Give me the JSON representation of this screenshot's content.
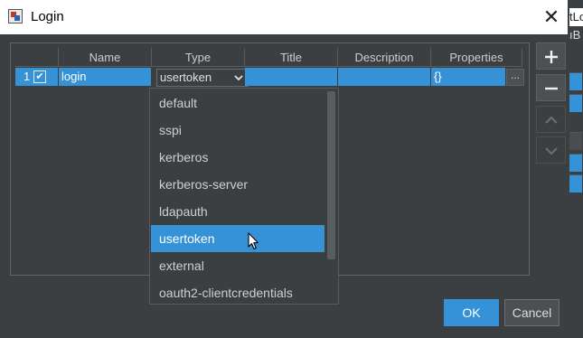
{
  "window": {
    "title": "Login",
    "close_symbol": "✕"
  },
  "background_peek": {
    "line1": "tLo",
    "line2": "ıB"
  },
  "table": {
    "columns": [
      "Name",
      "Type",
      "Title",
      "Description",
      "Properties"
    ],
    "rows": [
      {
        "index": "1",
        "enabled": true,
        "name": "login",
        "type": "usertoken",
        "title": "",
        "description": "",
        "properties": "{}"
      }
    ],
    "properties_button": "..."
  },
  "type_dropdown": {
    "options": [
      "default",
      "sspi",
      "kerberos",
      "kerberos-server",
      "ldapauth",
      "usertoken",
      "external",
      "oauth2-clientcredentials"
    ],
    "selected": "usertoken"
  },
  "side_buttons": [
    "add-icon",
    "remove-icon",
    "move-up-icon",
    "move-down-icon"
  ],
  "footer": {
    "ok": "OK",
    "cancel": "Cancel"
  },
  "colors": {
    "accent": "#3592d6",
    "background": "#3c3f41"
  }
}
